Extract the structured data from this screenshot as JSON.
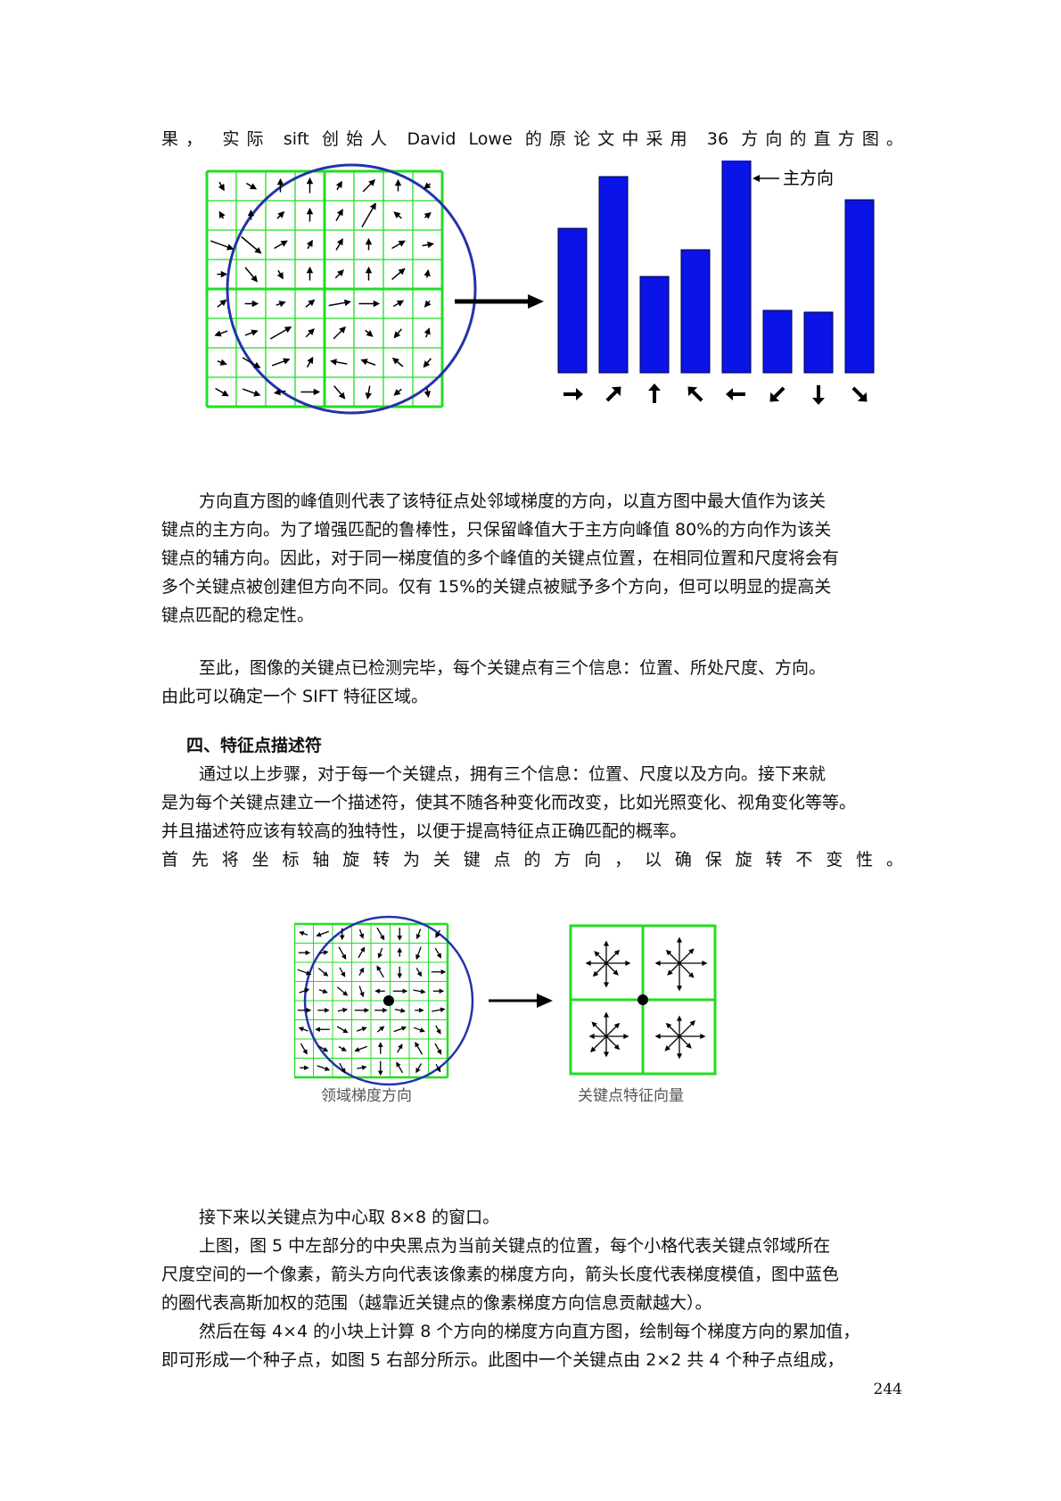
{
  "line_top": "果， 实际 sift 创始人 David Lowe 的原论文中采用 36 方向的直方图。",
  "figure1": {
    "main_direction_label": "主方向",
    "histogram_values": [
      162,
      220,
      108,
      138,
      256,
      70,
      68,
      194
    ],
    "bin_arrow_icons": [
      "arrow-right-icon",
      "arrow-up-right-icon",
      "arrow-up-icon",
      "arrow-up-left-icon",
      "arrow-left-icon",
      "arrow-down-left-icon",
      "arrow-down-icon",
      "arrow-down-right-icon"
    ]
  },
  "para1": [
    "方向直方图的峰值则代表了该特征点处邻域梯度的方向，以直方图中最大值作为该关",
    "键点的主方向。为了增强匹配的鲁棒性，只保留峰值大于主方向峰值 80%的方向作为该关",
    "键点的辅方向。因此，对于同一梯度值的多个峰值的关键点位置，在相同位置和尺度将会有",
    "多个关键点被创建但方向不同。仅有 15%的关键点被赋予多个方向，但可以明显的提高关",
    "键点匹配的稳定性。"
  ],
  "para2": [
    "至此，图像的关键点已检测完毕，每个关键点有三个信息：位置、所处尺度、方向。",
    "由此可以确定一个 SIFT 特征区域。"
  ],
  "heading": "四、特征点描述符",
  "para3": [
    "通过以上步骤，对于每一个关键点，拥有三个信息：位置、尺度以及方向。接下来就",
    "是为每个关键点建立一个描述符，使其不随各种变化而改变，比如光照变化、视角变化等等。",
    "并且描述符应该有较高的独特性，以便于提高特征点正确匹配的概率。"
  ],
  "line_rotate": "首先将坐标轴旋转为关键点的方向，以确保旋转不变性。",
  "figure2": {
    "left_caption": "领域梯度方向",
    "right_caption": "关键点特征向量"
  },
  "para4": [
    "接下来以关键点为中心取 8×8 的窗口。"
  ],
  "para5": [
    "上图，图 5 中左部分的中央黑点为当前关键点的位置，每个小格代表关键点邻域所在",
    "尺度空间的一个像素，箭头方向代表该像素的梯度方向，箭头长度代表梯度模值，图中蓝色",
    "的圈代表高斯加权的范围（越靠近关键点的像素梯度方向信息贡献越大）。"
  ],
  "para6": [
    "然后在每 4×4 的小块上计算 8 个方向的梯度方向直方图，绘制每个梯度方向的累加值，",
    "即可形成一个种子点，如图 5 右部分所示。此图中一个关键点由 2×2 共 4 个种子点组成，"
  ],
  "page_number": "244",
  "colors": {
    "grid": "#22dd22",
    "circle": "#2233aa",
    "bars": "#0a14e6"
  }
}
